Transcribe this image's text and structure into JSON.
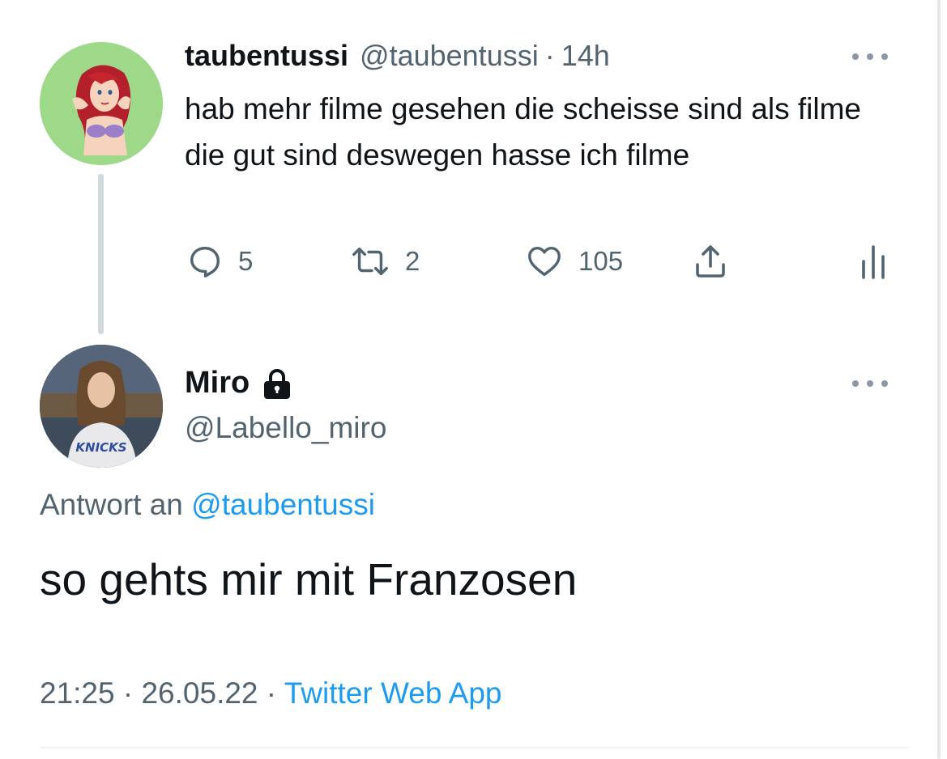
{
  "parent_tweet": {
    "display_name": "taubentussi",
    "handle": "@taubentussi",
    "separator": "·",
    "time": "14h",
    "text": "hab mehr filme gesehen die scheisse sind als filme die gut sind deswegen hasse ich filme",
    "actions": {
      "reply_count": "5",
      "retweet_count": "2",
      "like_count": "105"
    }
  },
  "reply_tweet": {
    "display_name": "Miro",
    "handle": "@Labello_miro",
    "reply_to_prefix": "Antwort an",
    "reply_to_handle": "@taubentussi",
    "text": "so gehts mir mit Franzosen",
    "time": "21:25",
    "separator": "·",
    "date": "26.05.22",
    "source": "Twitter Web App",
    "avatar_shirt_text": "KNICKS"
  },
  "icons": {
    "reply": "speech-bubble-icon",
    "retweet": "retweet-arrows-icon",
    "like": "heart-icon",
    "share": "share-upload-icon",
    "stats": "bar-stats-icon",
    "more": "ellipsis-icon",
    "protected": "lock-icon"
  },
  "colors": {
    "text_primary": "#0f1419",
    "text_secondary": "#536471",
    "link": "#1d9bf0",
    "thread_line": "#cfd9de"
  }
}
